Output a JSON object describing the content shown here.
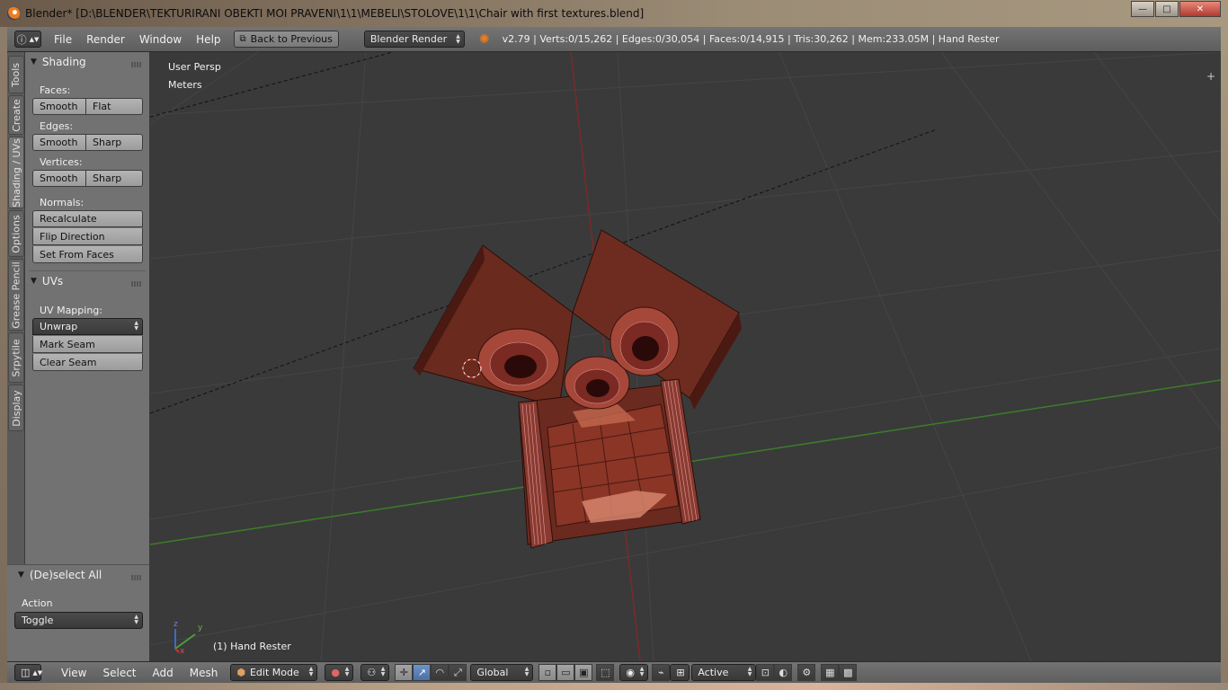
{
  "window": {
    "title": "Blender* [D:\\BLENDER\\TEKTURIRANI OBEKTI MOI PRAVENI\\1\\1\\MEBELI\\STOLOVE\\1\\1\\Chair with first textures.blend]",
    "minimize": "—",
    "maximize": "□",
    "close": "✕"
  },
  "infobar": {
    "menus": [
      "File",
      "Render",
      "Window",
      "Help"
    ],
    "back_button": "Back to Previous",
    "render_engine": "Blender Render",
    "stats": "v2.79 | Verts:0/15,262 | Edges:0/30,054 | Faces:0/14,915 | Tris:30,262 | Mem:233.05M | Hand Rester"
  },
  "sidetabs": [
    "Tools",
    "Create",
    "Shading / UVs",
    "Options",
    "Grease Pencil",
    "Srpytile",
    "Display"
  ],
  "shading_panel": {
    "title": "Shading",
    "faces_label": "Faces:",
    "faces_smooth": "Smooth",
    "faces_flat": "Flat",
    "edges_label": "Edges:",
    "edges_smooth": "Smooth",
    "edges_sharp": "Sharp",
    "vertices_label": "Vertices:",
    "vertices_smooth": "Smooth",
    "vertices_sharp": "Sharp",
    "normals_label": "Normals:",
    "recalculate": "Recalculate",
    "flip_direction": "Flip Direction",
    "set_from_faces": "Set From Faces"
  },
  "uvs_panel": {
    "title": "UVs",
    "uv_mapping_label": "UV Mapping:",
    "unwrap": "Unwrap",
    "mark_seam": "Mark Seam",
    "clear_seam": "Clear Seam"
  },
  "operator_panel": {
    "title": "(De)select All",
    "action_label": "Action",
    "action_value": "Toggle"
  },
  "viewport": {
    "view_name": "User Persp",
    "units": "Meters",
    "object_label": "(1) Hand Rester",
    "axis_x": "x",
    "axis_y": "y",
    "axis_z": "z"
  },
  "bottombar": {
    "menus": [
      "View",
      "Select",
      "Add",
      "Mesh"
    ],
    "mode": "Edit Mode",
    "orientation": "Global",
    "pivot": "Active"
  },
  "colors": {
    "ui_panel": "#727272",
    "viewport_bg": "#3a3a3a",
    "x_axis": "#8a2a2a",
    "y_axis": "#3c8a2a",
    "model_wood": "#7a2f22",
    "button_active": "#4a6fa3"
  }
}
